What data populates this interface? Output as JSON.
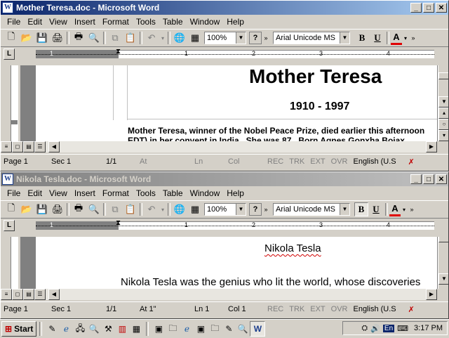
{
  "win1": {
    "title": "Mother Teresa.doc - Microsoft Word",
    "menu": [
      "File",
      "Edit",
      "View",
      "Insert",
      "Format",
      "Tools",
      "Table",
      "Window",
      "Help"
    ],
    "zoom": "100%",
    "help_btn": "?",
    "font": "Arial Unicode MS",
    "bold": "B",
    "underline": "U",
    "fontcolor": "A",
    "ruler_nums": [
      "1",
      "1",
      "2",
      "3",
      "4"
    ],
    "heading": "Mother Teresa",
    "dates": "1910 - 1997",
    "body1": "Mother Teresa, winner of the Nobel Peace Prize, died earlier this afternoon",
    "body2": "EDT) in her convent in India . She was 87 . Born Agnes Gonxha Bojax",
    "status": {
      "page": "Page 1",
      "sec": "Sec 1",
      "of": "1/1",
      "at": "At",
      "ln": "Ln",
      "col": "Col",
      "rec": "REC",
      "trk": "TRK",
      "ext": "EXT",
      "ovr": "OVR",
      "lang": "English (U.S"
    }
  },
  "win2": {
    "title": "Nikola Tesla.doc - Microsoft Word",
    "menu": [
      "File",
      "Edit",
      "View",
      "Insert",
      "Format",
      "Tools",
      "Table",
      "Window",
      "Help"
    ],
    "zoom": "100%",
    "help_btn": "?",
    "font": "Arial Unicode MS",
    "bold": "B",
    "underline": "U",
    "fontcolor": "A",
    "ruler_nums": [
      "1",
      "1",
      "2",
      "3",
      "4"
    ],
    "heading": "Nikola Tesla",
    "body1": "Nikola Tesla was the genius who lit the world, whose discoveries",
    "status": {
      "page": "Page 1",
      "sec": "Sec 1",
      "of": "1/1",
      "at": "At 1\"",
      "ln": "Ln 1",
      "col": "Col 1",
      "rec": "REC",
      "trk": "TRK",
      "ext": "EXT",
      "ovr": "OVR",
      "lang": "English (U.S"
    }
  },
  "taskbar": {
    "start": "Start",
    "time": "3:17 PM",
    "lang": "En"
  }
}
